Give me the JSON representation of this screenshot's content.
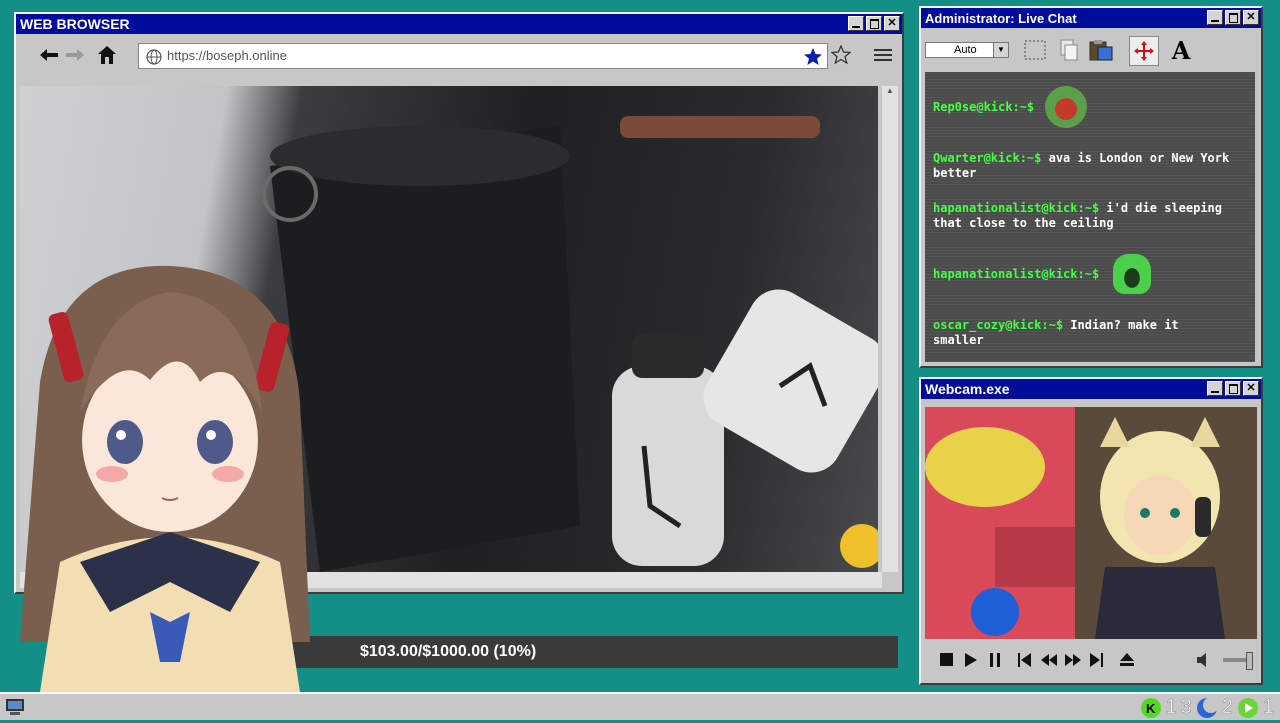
{
  "browser": {
    "title": "WEB BROWSER",
    "url": "https://boseph.online"
  },
  "chat": {
    "title": "Administrator: Live Chat",
    "font_select": "Auto",
    "messages": [
      {
        "user": "Rep0se@kick:~$",
        "text": "",
        "emote": "pepe-emote"
      },
      {
        "user": "Qwarter@kick:~$",
        "text": " ava is London or New York better"
      },
      {
        "user": "hapanationalist@kick:~$",
        "text": " i'd die sleeping that close to the ceiling"
      },
      {
        "user": "hapanationalist@kick:~$",
        "text": "",
        "emote": "green-scream-emote"
      },
      {
        "user": "oscar_cozy@kick:~$",
        "text": " Indian? make it smaller"
      }
    ]
  },
  "webcam": {
    "title": "Webcam.exe"
  },
  "donation": {
    "text": "$103.00/$1000.00 (10%)",
    "progress": 0.1
  },
  "tray": {
    "counts": [
      "1",
      "3",
      "2",
      "1"
    ]
  },
  "colors": {
    "desktop": "#138f86",
    "titlebar": "#000c9c",
    "chat_user": "#44ff44"
  }
}
